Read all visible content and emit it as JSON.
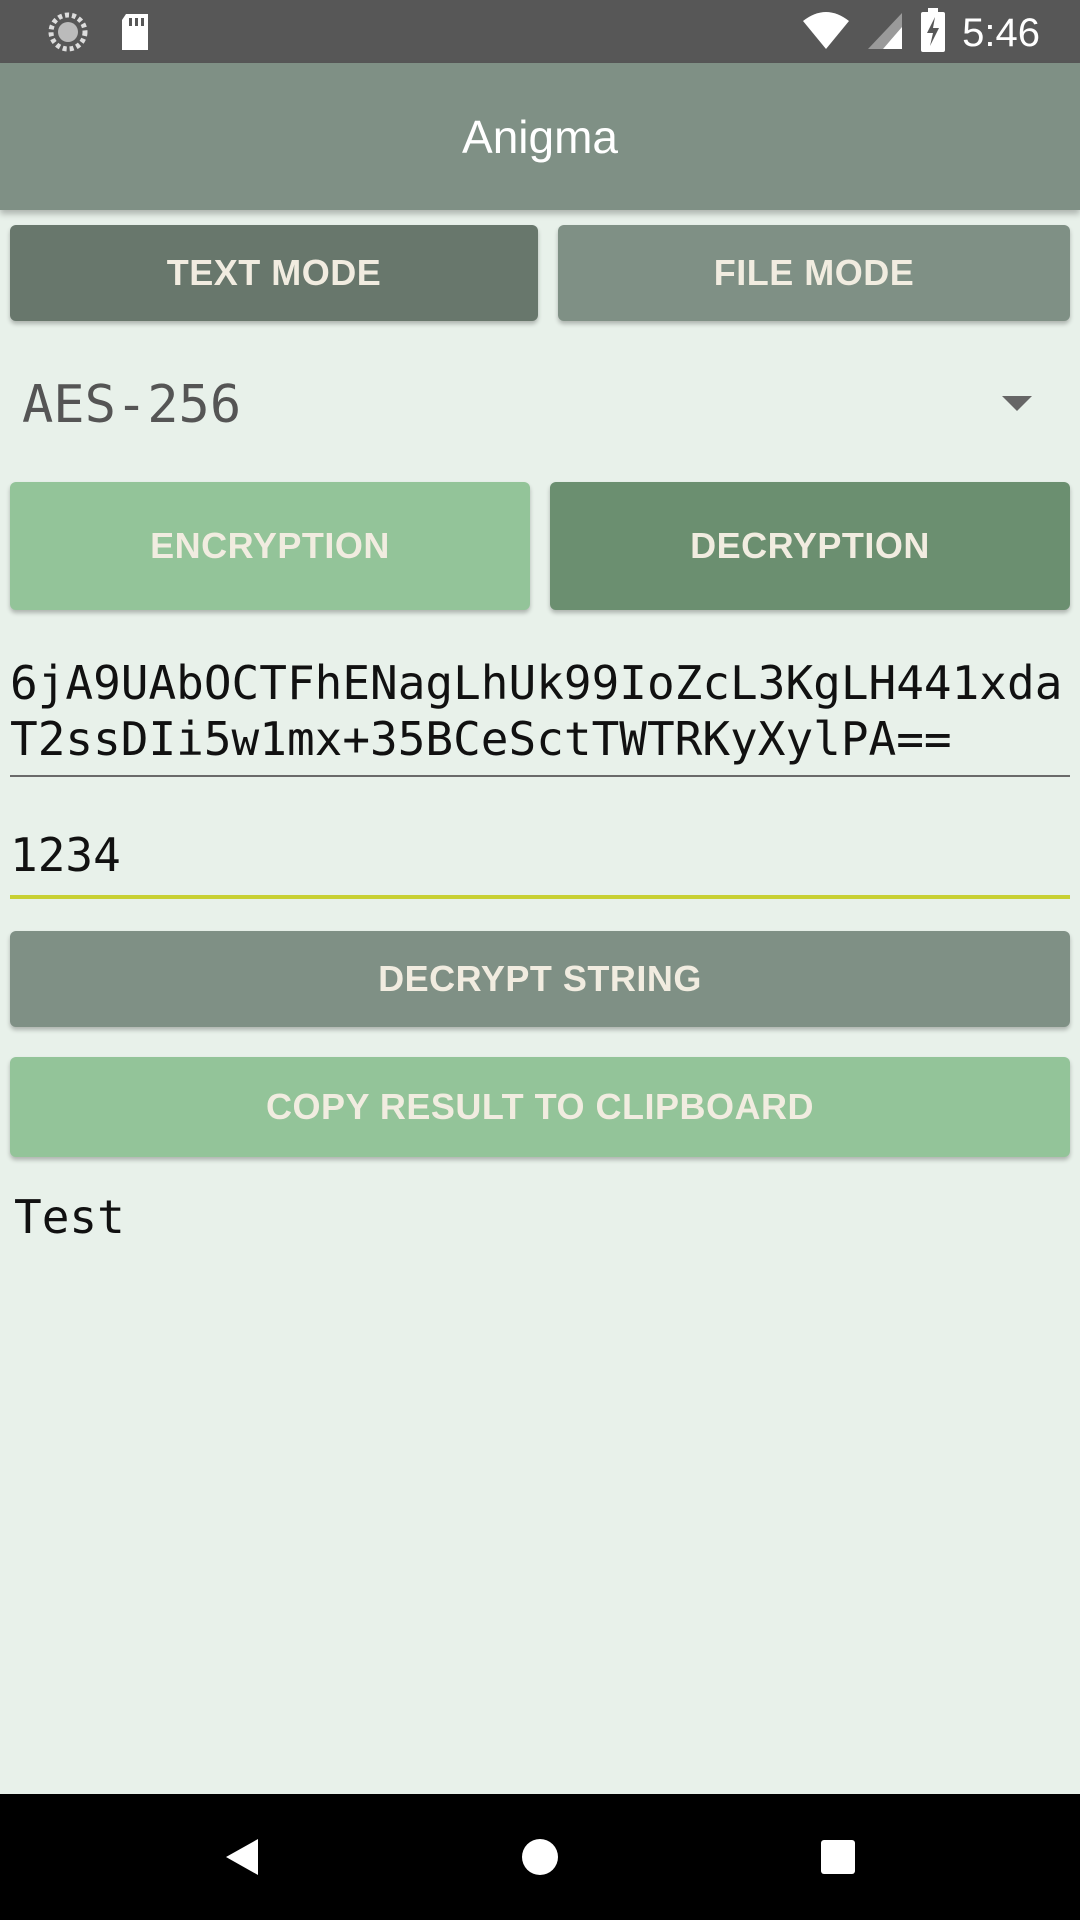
{
  "status_bar": {
    "time": "5:46",
    "icons": [
      "sync-icon",
      "sd-card-icon",
      "wifi-icon",
      "signal-icon",
      "battery-charging-icon"
    ]
  },
  "app_bar": {
    "title": "Anigma"
  },
  "mode_buttons": {
    "text_mode": "TEXT MODE",
    "file_mode": "FILE MODE"
  },
  "algorithm": {
    "selected": "AES-256"
  },
  "operation_buttons": {
    "encryption": "ENCRYPTION",
    "decryption": "DECRYPTION"
  },
  "cipher_input": {
    "value": "6jA9UAbOCTFhENagLhUk99IoZcL3KgLH441xdaT2ssDIi5w1mx+35BCeSctTWTRKyXylPA=="
  },
  "key_input": {
    "value": "1234"
  },
  "actions": {
    "decrypt": "DECRYPT STRING",
    "copy": "COPY RESULT TO CLIPBOARD"
  },
  "result": {
    "text": "Test"
  },
  "colors": {
    "app_bar": "#7f9085",
    "background": "#e8f1ea",
    "accent_underline": "#c8d033",
    "button_light": "#93c499",
    "button_dark": "#68776c"
  }
}
